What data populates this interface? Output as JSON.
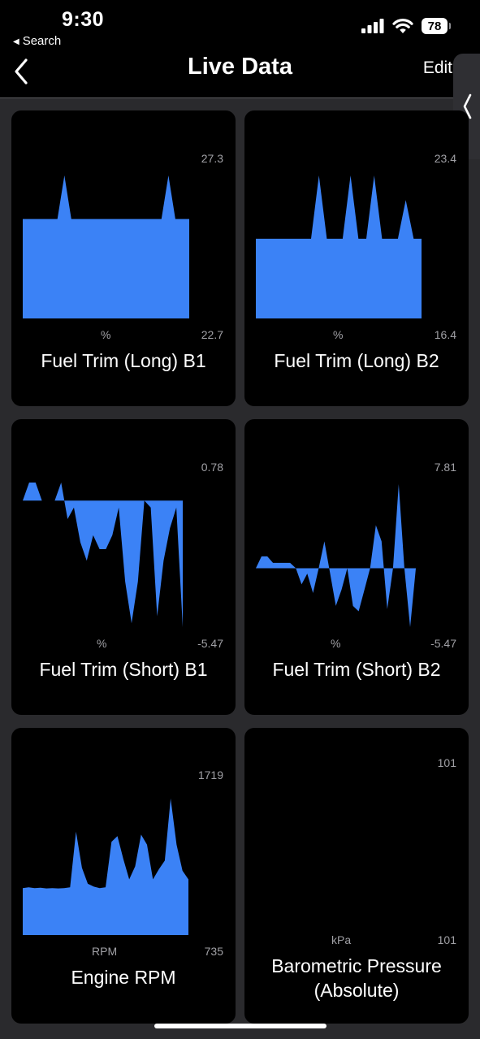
{
  "status_bar": {
    "time": "9:30",
    "back_app": "Search",
    "battery": "78"
  },
  "nav": {
    "title": "Live Data",
    "edit_label": "Edit"
  },
  "accent_color": "#3b82f6",
  "cards": [
    {
      "label": "Fuel Trim (Long) B1",
      "unit": "%",
      "max": "27.3",
      "min": "22.7",
      "chart_data": {
        "type": "area",
        "ylim": [
          22.7,
          27.3
        ],
        "baseline": 22.7,
        "values": [
          25.9,
          25.9,
          25.9,
          25.9,
          25.9,
          25.9,
          27.3,
          25.9,
          25.9,
          25.9,
          25.9,
          25.9,
          25.9,
          25.9,
          25.9,
          25.9,
          25.9,
          25.9,
          25.9,
          25.9,
          25.9,
          27.3,
          25.9,
          25.9,
          25.9
        ]
      }
    },
    {
      "label": "Fuel Trim (Long) B2",
      "unit": "%",
      "max": "23.4",
      "min": "16.4",
      "chart_data": {
        "type": "area",
        "ylim": [
          16.4,
          23.4
        ],
        "baseline": 16.4,
        "values": [
          20.3,
          20.3,
          20.3,
          20.3,
          20.3,
          20.3,
          20.3,
          20.3,
          23.4,
          20.3,
          20.3,
          20.3,
          23.4,
          20.3,
          20.3,
          23.4,
          20.3,
          20.3,
          20.3,
          22.2,
          20.3,
          20.3
        ]
      }
    },
    {
      "label": "Fuel Trim (Short) B1",
      "unit": "%",
      "max": "0.78",
      "min": "-5.47",
      "chart_data": {
        "type": "area",
        "ylim": [
          -5.47,
          0.78
        ],
        "baseline": 0,
        "values": [
          0,
          0.78,
          0.78,
          0,
          null,
          0,
          0.78,
          -0.8,
          -0.3,
          -1.8,
          -2.6,
          -1.5,
          -2.1,
          -2.1,
          -1.5,
          -0.3,
          -3.5,
          -5.3,
          -3.5,
          0,
          -0.3,
          -5.0,
          -2.6,
          -1.2,
          -0.3,
          -5.47
        ]
      }
    },
    {
      "label": "Fuel Trim (Short) B2",
      "unit": "%",
      "max": "7.81",
      "min": "-5.47",
      "chart_data": {
        "type": "area",
        "ylim": [
          -5.47,
          7.81
        ],
        "baseline": 0,
        "values": [
          0,
          1.1,
          1.1,
          0.5,
          0.5,
          0.5,
          0.5,
          0,
          -1.5,
          -0.5,
          -2.3,
          0,
          2.5,
          -0.5,
          -3.5,
          -2.0,
          0,
          -3.5,
          -4.0,
          -2.0,
          0,
          4.0,
          2.5,
          -3.8,
          0,
          7.81,
          0,
          -5.47,
          0
        ]
      }
    },
    {
      "label": "Engine RPM",
      "unit": "RPM",
      "max": "1719",
      "min": "735",
      "chart_data": {
        "type": "area",
        "ylim": [
          735,
          1719
        ],
        "baseline": 735,
        "values": [
          1060,
          1065,
          1060,
          1063,
          1058,
          1060,
          1058,
          1060,
          1065,
          1450,
          1200,
          1090,
          1070,
          1060,
          1065,
          1380,
          1420,
          1260,
          1120,
          1210,
          1430,
          1360,
          1120,
          1190,
          1250,
          1680,
          1360,
          1180,
          1120
        ]
      }
    },
    {
      "label": "Barometric Pressure (Absolute)",
      "unit": "kPa",
      "max": "101",
      "min": "101",
      "chart_data": {
        "type": "area",
        "ylim": [
          101,
          101
        ],
        "baseline": 101,
        "values": [
          101,
          101,
          101,
          101,
          101,
          101,
          101,
          101,
          101,
          101,
          101,
          101,
          101,
          101,
          101,
          101,
          101,
          101,
          101,
          101
        ]
      }
    }
  ]
}
